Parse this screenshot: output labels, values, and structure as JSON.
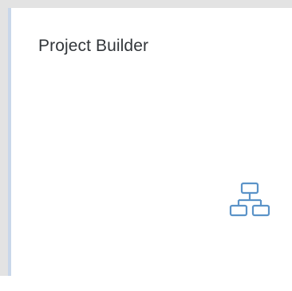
{
  "tile": {
    "title": "Project Builder",
    "icon": "hierarchy-icon",
    "accent_color": "#c9d7ea",
    "icon_color": "#5b93c8"
  }
}
